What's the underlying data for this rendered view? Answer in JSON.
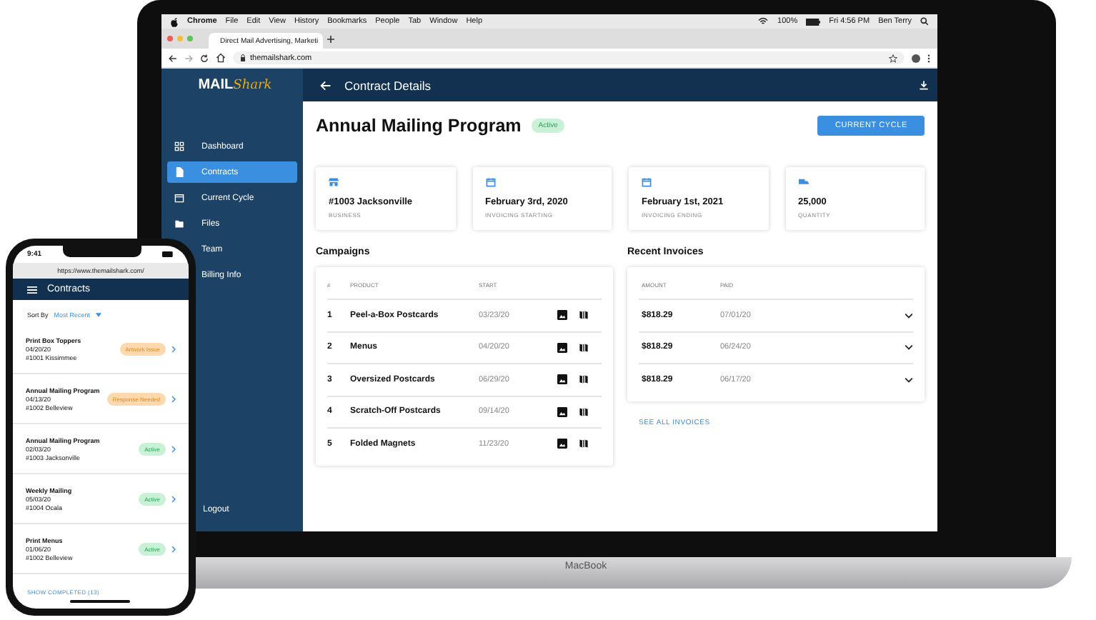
{
  "macos_menu_bar": {
    "app": "Chrome",
    "menus": [
      "File",
      "Edit",
      "View",
      "History",
      "Bookmarks",
      "People",
      "Tab",
      "Window",
      "Help"
    ],
    "battery": "100%",
    "clock": "Fri 4:56 PM",
    "user": "Ben Terry"
  },
  "browser": {
    "tab_title": "Direct Mail Advertising, Marketi",
    "url": "themailshark.com"
  },
  "app": {
    "logo": {
      "word": "MAIL",
      "script": "Shark"
    },
    "header": {
      "title": "Contract Details"
    },
    "sidebar": {
      "items": [
        {
          "label": "Dashboard",
          "selected": false
        },
        {
          "label": "Contracts",
          "selected": true
        },
        {
          "label": "Current Cycle",
          "selected": false
        },
        {
          "label": "Files",
          "selected": false
        },
        {
          "label": "Team",
          "selected": false
        },
        {
          "label": "Billing Info",
          "selected": false
        }
      ],
      "logout": "Logout"
    },
    "title": "Annual Mailing Program",
    "status": {
      "label": "Active",
      "kind": "success"
    },
    "primary_button": "CURRENT CYCLE",
    "info_cards": [
      {
        "value": "#1003 Jacksonville",
        "label": "BUSINESS"
      },
      {
        "value": "February 3rd, 2020",
        "label": "INVOICING STARTING"
      },
      {
        "value": "February 1st, 2021",
        "label": "INVOICING ENDING"
      },
      {
        "value": "25,000",
        "label": "QUANTITY"
      }
    ],
    "campaigns": {
      "title": "Campaigns",
      "columns": [
        "#",
        "PRODUCT",
        "START"
      ],
      "rows": [
        {
          "number": "1",
          "product": "Peel-a-Box Postcards",
          "start": "03/23/20"
        },
        {
          "number": "2",
          "product": "Menus",
          "start": "04/20/20"
        },
        {
          "number": "3",
          "product": "Oversized Postcards",
          "start": "06/29/20"
        },
        {
          "number": "4",
          "product": "Scratch-Off Postcards",
          "start": "09/14/20"
        },
        {
          "number": "5",
          "product": "Folded Magnets",
          "start": "11/23/20"
        }
      ]
    },
    "invoices": {
      "title": "Recent Invoices",
      "columns": [
        "AMOUNT",
        "PAID"
      ],
      "rows": [
        {
          "amount": "$818.29",
          "paid": "07/01/20"
        },
        {
          "amount": "$818.29",
          "paid": "06/24/20"
        },
        {
          "amount": "$818.29",
          "paid": "06/17/20"
        }
      ],
      "link": "SEE ALL INVOICES"
    }
  },
  "laptop_label": "MacBook",
  "phone": {
    "time": "9:41",
    "url": "https://www.themailshark.com/",
    "title": "Contracts",
    "sort_label": "Sort By",
    "sort_value": "Most Recent",
    "items": [
      {
        "title": "Print Box Toppers",
        "date": "04/20/20",
        "location": "#1001 Kissimmee",
        "status": {
          "label": "Artwork Issue",
          "kind": "warning"
        }
      },
      {
        "title": "Annual Mailing Program",
        "date": "04/13/20",
        "location": "#1002 Belleview",
        "status": {
          "label": "Response Needed",
          "kind": "warning"
        }
      },
      {
        "title": "Annual Mailing Program",
        "date": "02/03/20",
        "location": "#1003 Jacksonville",
        "status": {
          "label": "Active",
          "kind": "success"
        }
      },
      {
        "title": "Weekly Mailing",
        "date": "05/03/20",
        "location": "#1004 Ocala",
        "status": {
          "label": "Active",
          "kind": "success"
        }
      },
      {
        "title": "Print Menus",
        "date": "01/06/20",
        "location": "#1002 Belleview",
        "status": {
          "label": "Active",
          "kind": "success"
        }
      }
    ],
    "footer_link": "SHOW COMPLETED (13)"
  }
}
